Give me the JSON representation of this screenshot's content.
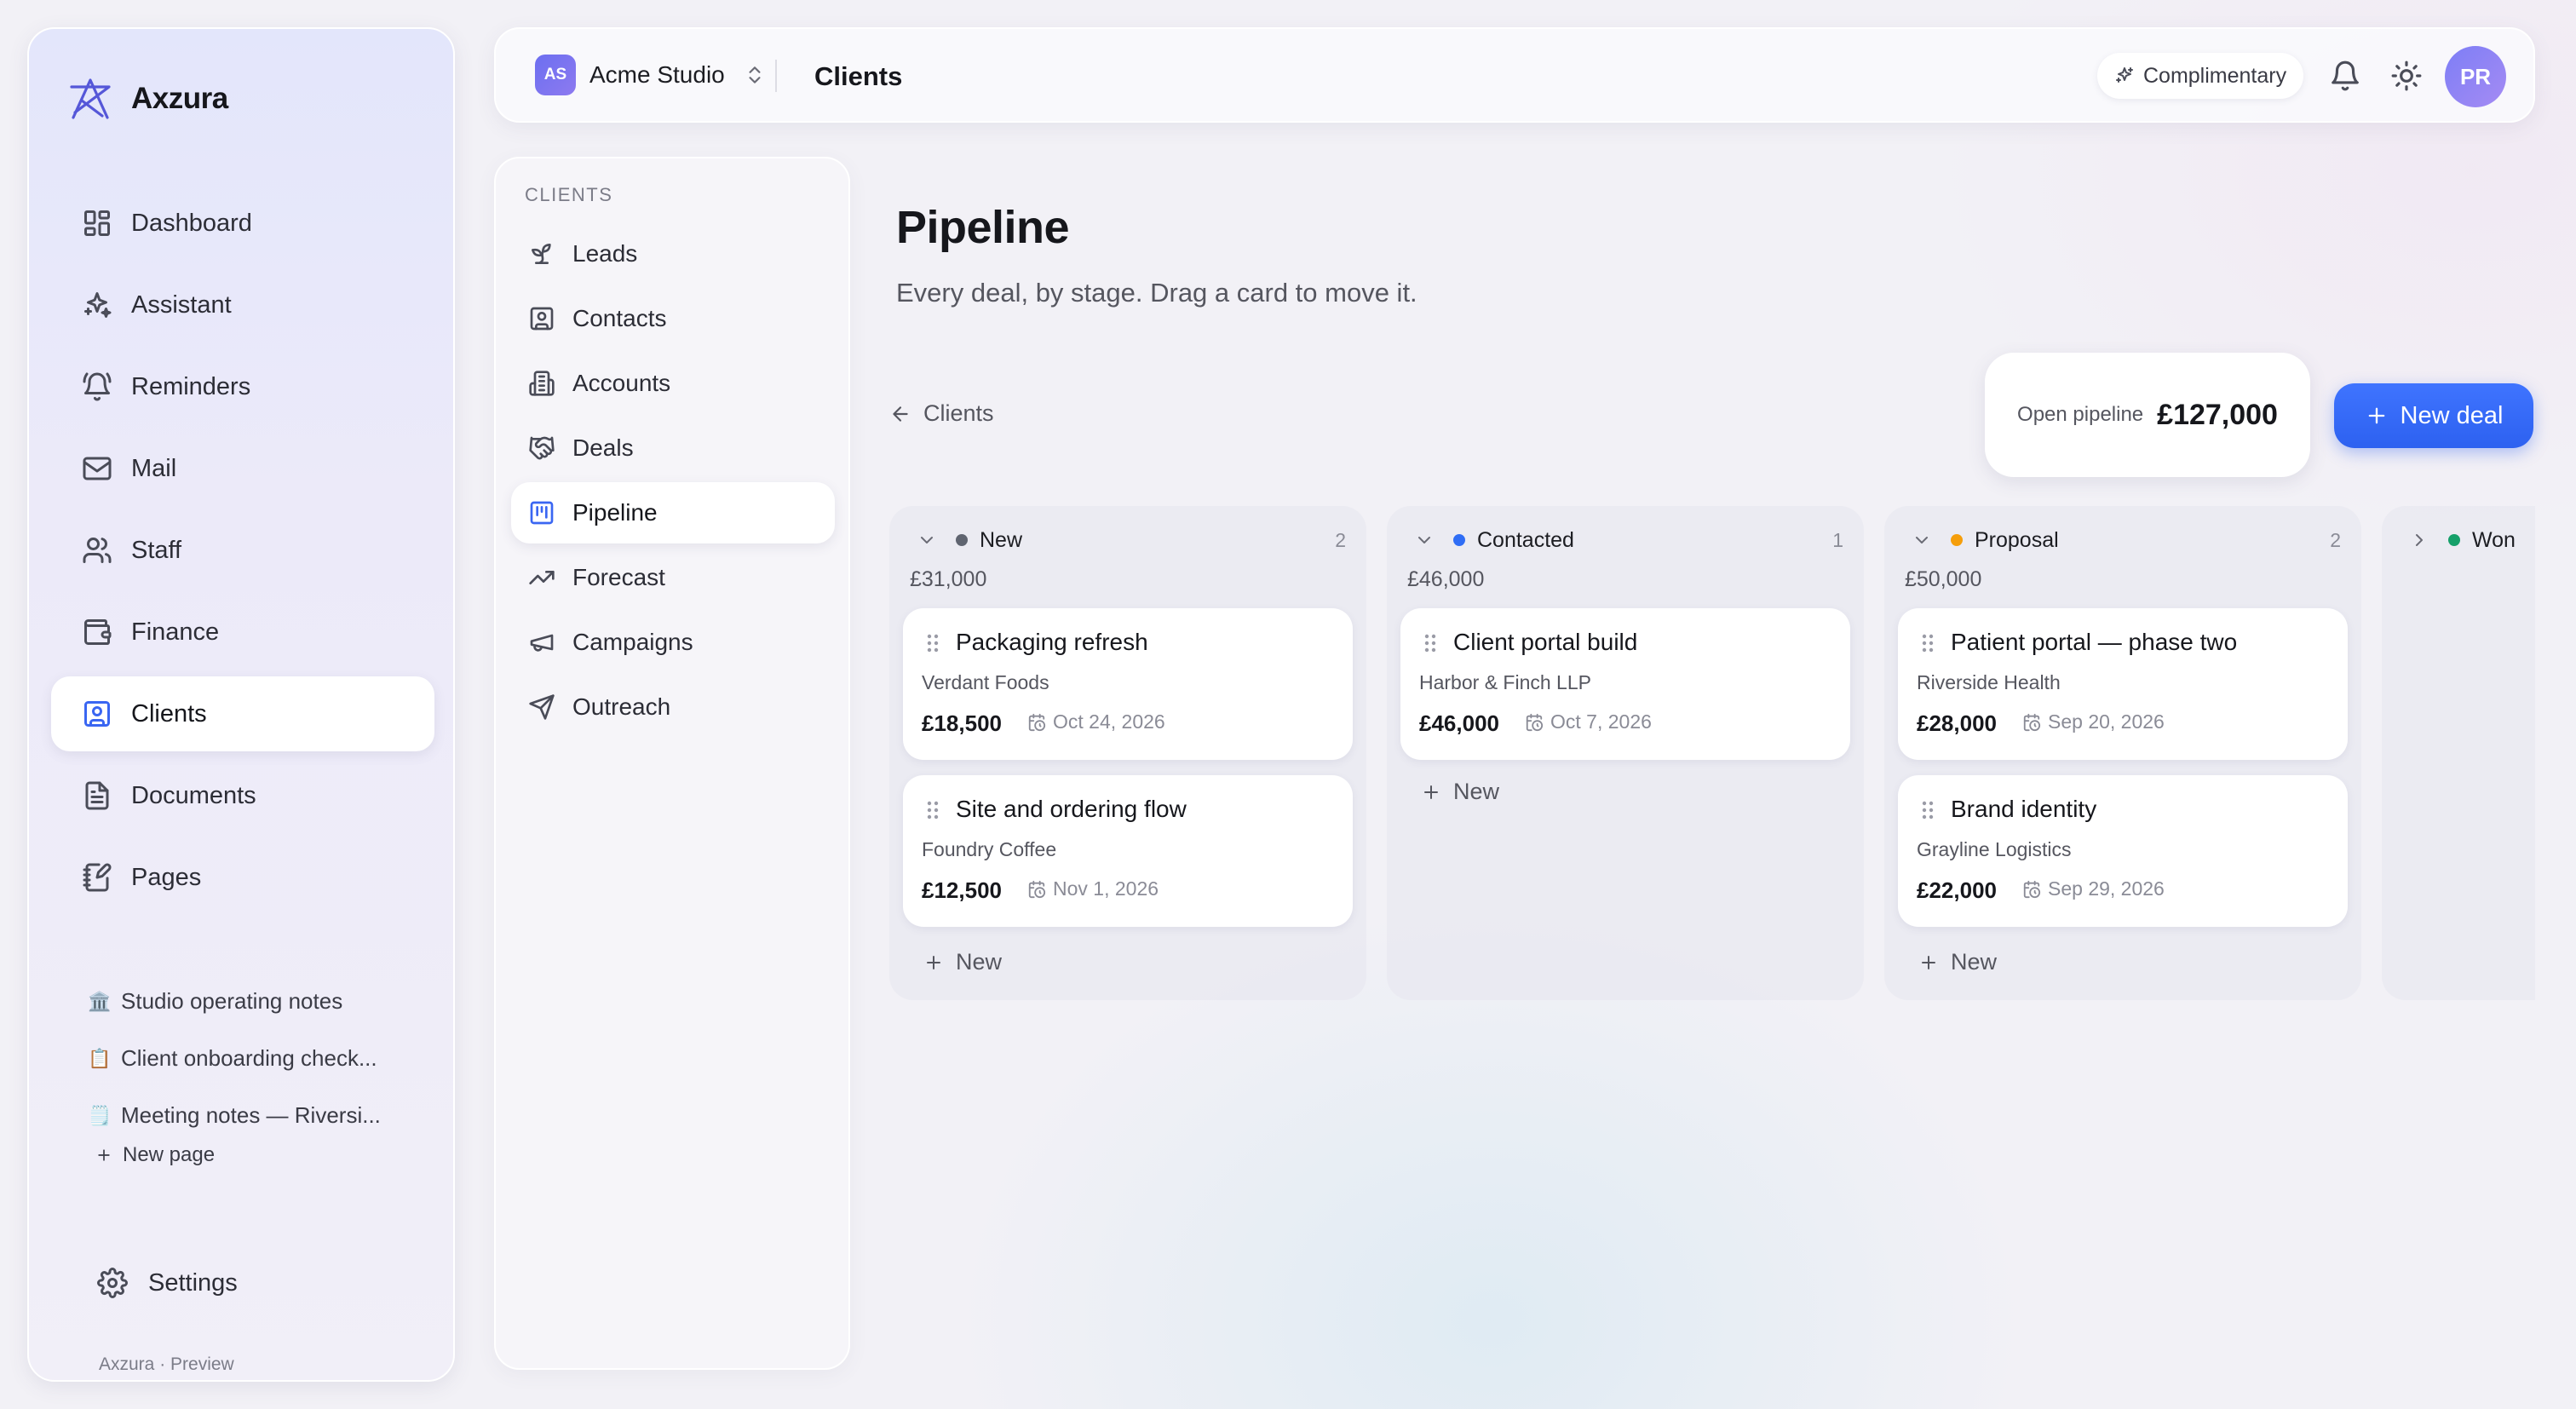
{
  "app": {
    "name": "Axzura",
    "footer": "Axzura · Preview"
  },
  "sidebar": {
    "items": [
      {
        "label": "Dashboard",
        "icon": "dashboard-icon"
      },
      {
        "label": "Assistant",
        "icon": "sparkles-icon"
      },
      {
        "label": "Reminders",
        "icon": "bell-ring-icon"
      },
      {
        "label": "Mail",
        "icon": "mail-icon"
      },
      {
        "label": "Staff",
        "icon": "users-icon"
      },
      {
        "label": "Finance",
        "icon": "wallet-icon"
      },
      {
        "label": "Clients",
        "icon": "contact-card-icon",
        "active": true
      },
      {
        "label": "Documents",
        "icon": "document-icon"
      },
      {
        "label": "Pages",
        "icon": "notebook-pen-icon"
      }
    ],
    "pages": [
      {
        "emoji": "🏛️",
        "label": "Studio operating notes"
      },
      {
        "emoji": "📋",
        "label": "Client onboarding check..."
      },
      {
        "emoji": "🗒️",
        "label": "Meeting notes — Riversi..."
      }
    ],
    "new_page_label": "New page",
    "settings_label": "Settings"
  },
  "topbar": {
    "workspace_initials": "AS",
    "workspace_name": "Acme Studio",
    "title": "Clients",
    "plan_label": "Complimentary",
    "avatar_initials": "PR"
  },
  "subnav": {
    "heading": "CLIENTS",
    "items": [
      {
        "label": "Leads",
        "icon": "sprout-icon"
      },
      {
        "label": "Contacts",
        "icon": "contact-square-icon"
      },
      {
        "label": "Accounts",
        "icon": "building-icon"
      },
      {
        "label": "Deals",
        "icon": "handshake-icon"
      },
      {
        "label": "Pipeline",
        "icon": "kanban-icon",
        "active": true
      },
      {
        "label": "Forecast",
        "icon": "trending-up-icon"
      },
      {
        "label": "Campaigns",
        "icon": "megaphone-icon"
      },
      {
        "label": "Outreach",
        "icon": "send-icon"
      }
    ]
  },
  "main": {
    "title": "Pipeline",
    "subtitle": "Every deal, by stage. Drag a card to move it.",
    "back_label": "Clients",
    "open_pipeline_label": "Open pipeline",
    "open_pipeline_value": "£127,000",
    "new_deal_label": "New deal",
    "new_card_label": "New"
  },
  "colors": {
    "accent": "#2d61f0",
    "stage_new": "#5f6470",
    "stage_contacted": "#2f6df5",
    "stage_proposal": "#f59e0b",
    "stage_won": "#16a06a"
  },
  "columns": [
    {
      "name": "New",
      "count": "2",
      "total": "£31,000",
      "dot": "#5f6470",
      "collapsed": false,
      "cards": [
        {
          "title": "Packaging refresh",
          "client": "Verdant Foods",
          "amount": "£18,500",
          "date": "Oct 24, 2026"
        },
        {
          "title": "Site and ordering flow",
          "client": "Foundry Coffee",
          "amount": "£12,500",
          "date": "Nov 1, 2026"
        }
      ]
    },
    {
      "name": "Contacted",
      "count": "1",
      "total": "£46,000",
      "dot": "#2f6df5",
      "collapsed": false,
      "cards": [
        {
          "title": "Client portal build",
          "client": "Harbor & Finch LLP",
          "amount": "£46,000",
          "date": "Oct 7, 2026"
        }
      ]
    },
    {
      "name": "Proposal",
      "count": "2",
      "total": "£50,000",
      "dot": "#f59e0b",
      "collapsed": false,
      "cards": [
        {
          "title": "Patient portal — phase two",
          "client": "Riverside Health",
          "amount": "£28,000",
          "date": "Sep 20, 2026"
        },
        {
          "title": "Brand identity",
          "client": "Grayline Logistics",
          "amount": "£22,000",
          "date": "Sep 29, 2026"
        }
      ]
    },
    {
      "name": "Won",
      "count": "",
      "total": "",
      "dot": "#16a06a",
      "collapsed": true,
      "cards": []
    }
  ]
}
